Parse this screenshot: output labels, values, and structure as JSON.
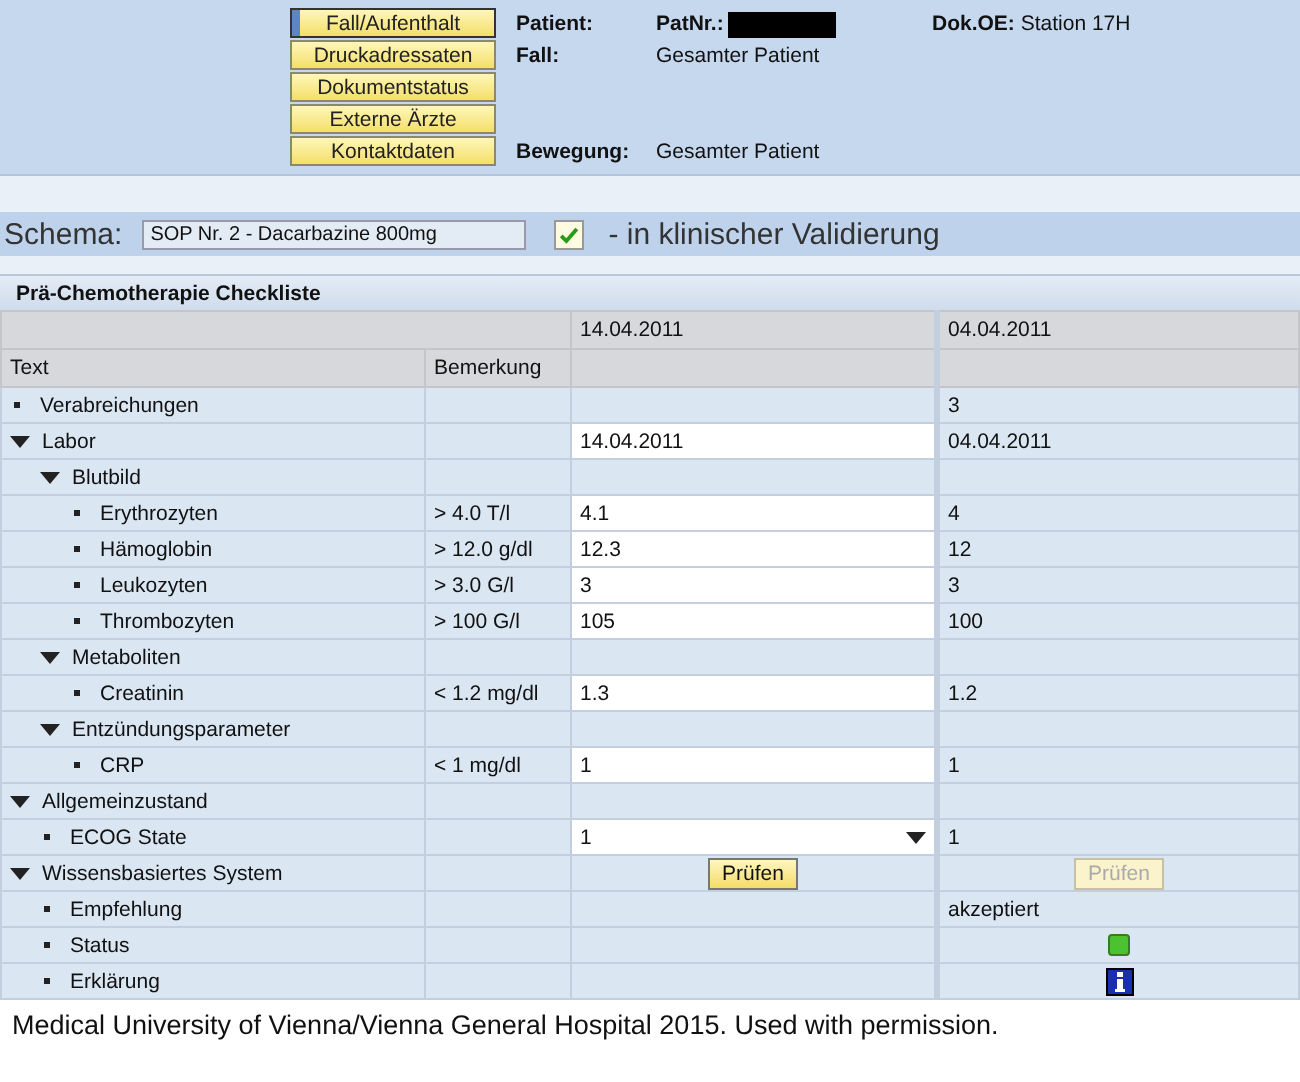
{
  "nav_buttons": [
    {
      "label": "Fall/Aufenthalt",
      "selected": true
    },
    {
      "label": "Druckadressaten",
      "selected": false
    },
    {
      "label": "Dokumentstatus",
      "selected": false
    },
    {
      "label": "Externe Ärzte",
      "selected": false
    },
    {
      "label": "Kontaktdaten",
      "selected": false
    }
  ],
  "patient_info": {
    "patient_label": "Patient:",
    "patnr_label": "PatNr.:",
    "patnr_redacted": true,
    "dok_label": "Dok.OE:",
    "dok_value": "Station 17H",
    "fall_label": "Fall:",
    "fall_value": "Gesamter Patient",
    "bewegung_label": "Bewegung:",
    "bewegung_value": "Gesamter Patient"
  },
  "schema": {
    "label": "Schema:",
    "value": "SOP Nr. 2 - Dacarbazine 800mg",
    "checked": true,
    "status": "- in klinischer Validierung"
  },
  "checklist": {
    "title": "Prä-Chemotherapie Checkliste",
    "dates": [
      "14.04.2011",
      "04.04.2011"
    ],
    "columns": [
      "Text",
      "Bemerkung"
    ],
    "rows": [
      {
        "label": "Verabreichungen",
        "previous": {
          "kind": "text",
          "value": "3"
        }
      },
      {
        "label": "Labor",
        "expanded": true,
        "current": {
          "kind": "input",
          "value": "14.04.2011"
        },
        "previous": {
          "kind": "text",
          "value": "04.04.2011"
        },
        "children": [
          {
            "label": "Blutbild",
            "expanded": true,
            "children": [
              {
                "label": "Erythrozyten",
                "remark": "> 4.0 T/l",
                "current": {
                  "kind": "input",
                  "value": "4.1"
                },
                "previous": {
                  "kind": "text",
                  "value": "4"
                }
              },
              {
                "label": "Hämoglobin",
                "remark": "> 12.0 g/dl",
                "current": {
                  "kind": "input",
                  "value": "12.3"
                },
                "previous": {
                  "kind": "text",
                  "value": "12"
                }
              },
              {
                "label": "Leukozyten",
                "remark": "> 3.0 G/l",
                "current": {
                  "kind": "input",
                  "value": "3"
                },
                "previous": {
                  "kind": "text",
                  "value": "3"
                }
              },
              {
                "label": "Thrombozyten",
                "remark": "> 100 G/l",
                "current": {
                  "kind": "input",
                  "value": "105"
                },
                "previous": {
                  "kind": "text",
                  "value": "100"
                }
              }
            ]
          },
          {
            "label": "Metaboliten",
            "expanded": true,
            "children": [
              {
                "label": "Creatinin",
                "remark": "< 1.2 mg/dl",
                "current": {
                  "kind": "input",
                  "value": "1.3"
                },
                "previous": {
                  "kind": "text",
                  "value": "1.2"
                }
              }
            ]
          },
          {
            "label": "Entzündungsparameter",
            "expanded": true,
            "children": [
              {
                "label": "CRP",
                "remark": "< 1 mg/dl",
                "current": {
                  "kind": "input",
                  "value": "1"
                },
                "previous": {
                  "kind": "text",
                  "value": "1"
                }
              }
            ]
          }
        ]
      },
      {
        "label": "Allgemeinzustand",
        "expanded": true,
        "children": [
          {
            "label": "ECOG State",
            "current": {
              "kind": "dropdown",
              "value": "1"
            },
            "previous": {
              "kind": "text",
              "value": "1"
            }
          }
        ]
      },
      {
        "label": "Wissensbasiertes System",
        "expanded": true,
        "current": {
          "kind": "button",
          "value": "Prüfen",
          "disabled": false
        },
        "previous": {
          "kind": "button",
          "value": "Prüfen",
          "disabled": true
        },
        "children": [
          {
            "label": "Empfehlung",
            "previous": {
              "kind": "text",
              "value": "akzeptiert"
            }
          },
          {
            "label": "Status",
            "previous": {
              "kind": "status",
              "color": "#4cc230"
            }
          },
          {
            "label": "Erklärung",
            "previous": {
              "kind": "info"
            }
          }
        ]
      }
    ]
  },
  "caption": "Medical University of Vienna/Vienna General Hospital 2015. Used with permission."
}
